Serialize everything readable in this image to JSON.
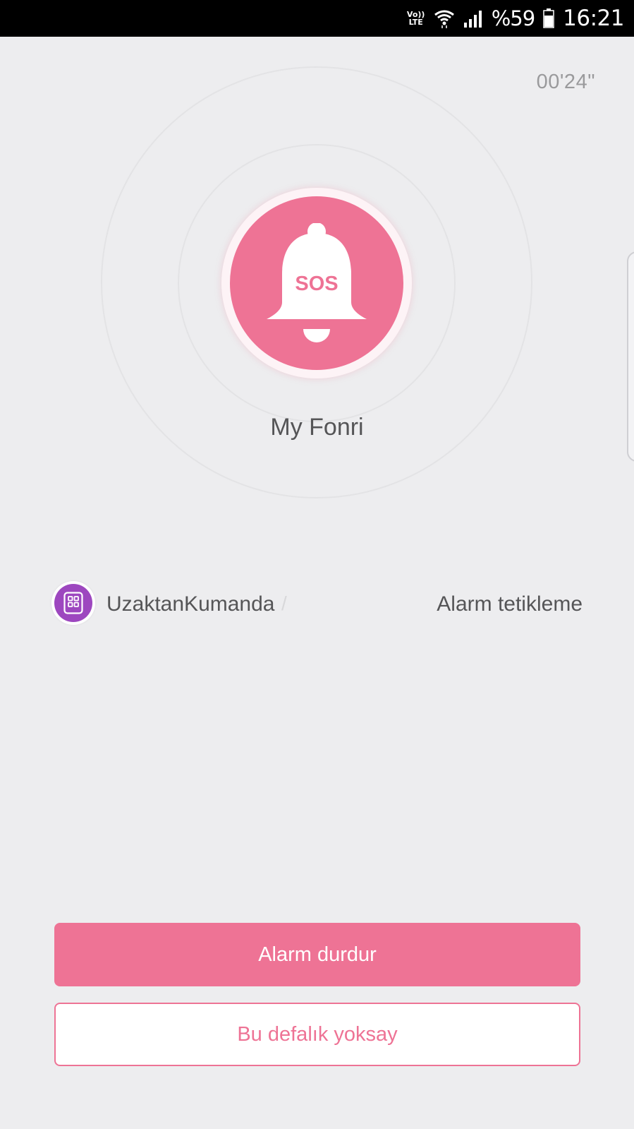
{
  "status_bar": {
    "network_label": "VoLTE",
    "volte_top": "Vo))",
    "volte_bottom": "LTE",
    "battery": "%59",
    "time": "16:21"
  },
  "alarm": {
    "elapsed": "00'24\"",
    "badge": "SOS",
    "device_name": "My Fonri",
    "accent_color": "#ee7395"
  },
  "event": {
    "source_icon": "remote-control-icon",
    "source_name": "UzaktanKumanda",
    "separator": "/",
    "type": "Alarm tetikleme",
    "icon_color": "#9d47bf"
  },
  "actions": {
    "stop_label": "Alarm durdur",
    "ignore_label": "Bu defalık yoksay"
  }
}
